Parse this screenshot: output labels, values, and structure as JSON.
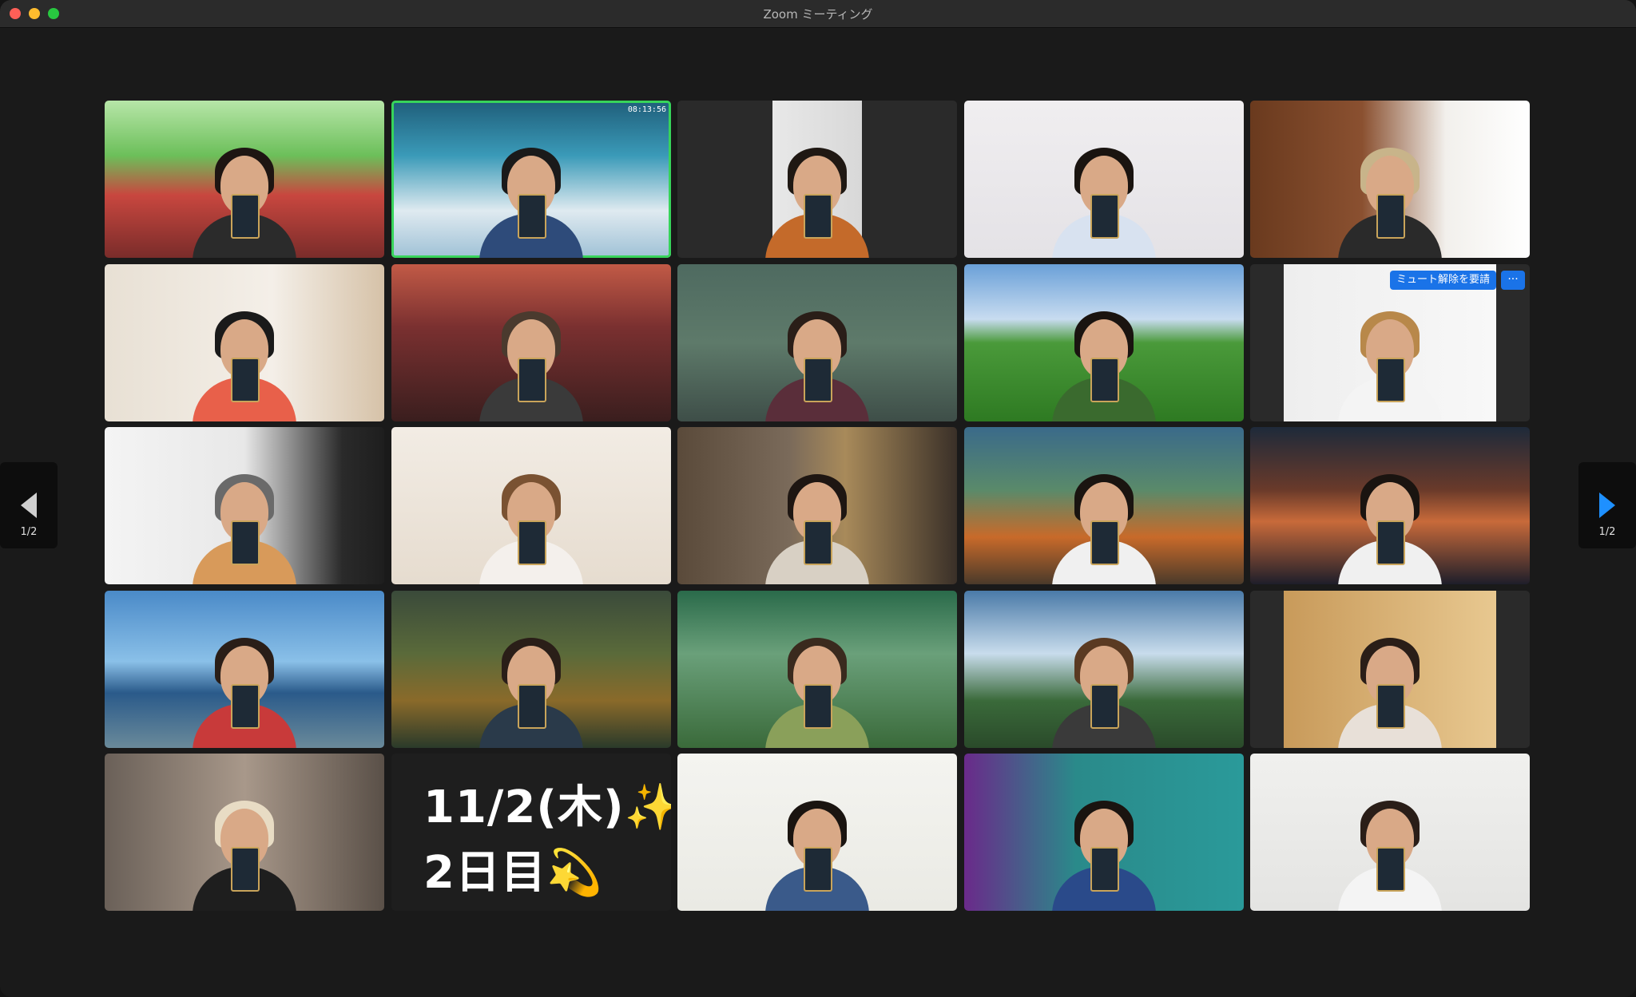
{
  "window": {
    "title": "Zoom ミーティング"
  },
  "pager": {
    "left_label": "1/2",
    "right_label": "1/2"
  },
  "colors": {
    "active_border": "#37d45a",
    "accent": "#1a73e8"
  },
  "tiles": [
    {
      "id": "t1",
      "bg": "linear-gradient(180deg,#b7e6a8 0%,#6cbf5a 35%,#c8473f 60%,#7a2c2a 100%)",
      "hair": "#1e1512",
      "shirt": "#2b2b2b"
    },
    {
      "id": "t2",
      "bg": "linear-gradient(180deg,#1f5e7a 0%,#3a9ab8 35%,#dfeaf0 70%,#9fc1d6 100%)",
      "hair": "#1a1a1a",
      "shirt": "#2e4b7a",
      "active": true
    },
    {
      "id": "t3",
      "bg": "linear-gradient(90deg,#2a2a2a 0%,#2a2a2a 34%,#e8e8e8 34%,#d8d8d8 66%,#2a2a2a 66%)",
      "hair": "#1f1813",
      "shirt": "#c46a2a"
    },
    {
      "id": "t4",
      "bg": "linear-gradient(180deg,#f0eef0 0%,#e4e2e6 100%)",
      "hair": "#1a1410",
      "shirt": "#d8e2f0"
    },
    {
      "id": "t5",
      "bg": "linear-gradient(90deg,#6a3a1e 0%,#8a5030 40%,#f2f0ec 70%,#ffffff 100%)",
      "hair": "#c8b48a",
      "shirt": "#2a2a2a"
    },
    {
      "id": "t6",
      "bg": "linear-gradient(90deg,#e8e0d4 0%,#f4efe8 60%,#d6c2a8 100%)",
      "hair": "#1a1a1a",
      "shirt": "#e8604a"
    },
    {
      "id": "t7",
      "bg": "linear-gradient(180deg,#c25a46 0%,#7a3030 40%,#3a1e1e 100%)",
      "hair": "#4a3a2e",
      "shirt": "#3a3a3a"
    },
    {
      "id": "t8",
      "bg": "linear-gradient(180deg,#4e6a60 0%,#5e7a6a 50%,#3e4e48 100%)",
      "hair": "#2a1e18",
      "shirt": "#5a2e3a"
    },
    {
      "id": "t9",
      "bg": "linear-gradient(180deg,#6aa0d8 0%,#c8dcf0 35%,#4a9a3a 50%,#2e7a22 100%)",
      "hair": "#1a1410",
      "shirt": "#3a6a2e"
    },
    {
      "id": "t10",
      "bg": "linear-gradient(90deg,#2a2a2a 0%,#2a2a2a 12%,#eeeeee 12%,#f8f8f8 88%,#2a2a2a 88%)",
      "hair": "#b8884a",
      "shirt": "#f4f4f4",
      "unmute": true
    },
    {
      "id": "t11",
      "bg": "linear-gradient(90deg,#f4f4f4 0%,#e8e8e8 50%,#2a2a2a 85%,#1e1e1e 100%)",
      "hair": "#6a6a6a",
      "shirt": "#d89a5a"
    },
    {
      "id": "t12",
      "bg": "linear-gradient(180deg,#f2ece4 0%,#e6dccf 100%)",
      "hair": "#7a5232",
      "shirt": "#f4f0ec"
    },
    {
      "id": "t13",
      "bg": "linear-gradient(90deg,#5a4a3a 0%,#7a6a5a 40%,#a88a5a 60%,#3a3028 100%)",
      "hair": "#1e1612",
      "shirt": "#d8d0c4"
    },
    {
      "id": "t14",
      "bg": "linear-gradient(180deg,#3a6a8a 0%,#5a8a6a 40%,#c86a2a 70%,#4a3a2a 100%)",
      "hair": "#1a1410",
      "shirt": "#f0f0f0"
    },
    {
      "id": "t15",
      "bg": "linear-gradient(180deg,#1e2a3a 0%,#6a3a2a 40%,#c86a3a 60%,#1e1e2a 100%)",
      "hair": "#1a1410",
      "shirt": "#f0f0f0"
    },
    {
      "id": "t16",
      "bg": "linear-gradient(180deg,#4a8ac8 0%,#8ac0e8 45%,#2a5a8a 65%,#6a8a9a 100%)",
      "hair": "#2a1e18",
      "shirt": "#c83a3a"
    },
    {
      "id": "t17",
      "bg": "linear-gradient(180deg,#3a4a3a 0%,#5a6a3a 40%,#8a6a2a 70%,#2a3a2a 100%)",
      "hair": "#2a1e18",
      "shirt": "#2a3a4a"
    },
    {
      "id": "t18",
      "bg": "linear-gradient(180deg,#2a6a4a 0%,#6aa07a 40%,#3a6a3a 100%)",
      "hair": "#3a2a1e",
      "shirt": "#8aa05a"
    },
    {
      "id": "t19",
      "bg": "linear-gradient(180deg,#4a7aa8 0%,#c8dcec 40%,#3a6a3a 70%,#2a4a2a 100%)",
      "hair": "#5a3a22",
      "shirt": "#3a3a3a"
    },
    {
      "id": "t20",
      "bg": "linear-gradient(90deg,#2a2a2a 0%,#2a2a2a 12%,#c89a5a 12%,#e8c890 88%,#2a2a2a 88%)",
      "hair": "#2a1e18",
      "shirt": "#e8e0d8"
    },
    {
      "id": "t21",
      "bg": "linear-gradient(90deg,#6a6058 0%,#a8988a 50%,#5a5048 100%)",
      "hair": "#e8dcc4",
      "shirt": "#1e1e1e"
    },
    {
      "id": "t22",
      "type": "text",
      "line1": "11/2(木)✨",
      "line2": "2日目💫"
    },
    {
      "id": "t23",
      "bg": "linear-gradient(180deg,#f4f4f0 0%,#eaeae4 100%)",
      "hair": "#1a1410",
      "shirt": "#3a5a8a"
    },
    {
      "id": "t24",
      "bg": "linear-gradient(90deg,#6a2a8a 0%,#2a8a8a 40%,#2a9a9a 100%)",
      "hair": "#1a1410",
      "shirt": "#2a4a8a"
    },
    {
      "id": "t25",
      "bg": "linear-gradient(180deg,#f0f0ee 0%,#e4e4e2 100%)",
      "hair": "#2a1e18",
      "shirt": "#f4f4f4"
    }
  ],
  "tile2_clock": "08:13:56",
  "tile10_unmute_label": "ミュート解除を要請",
  "tile10_more_label": "···"
}
